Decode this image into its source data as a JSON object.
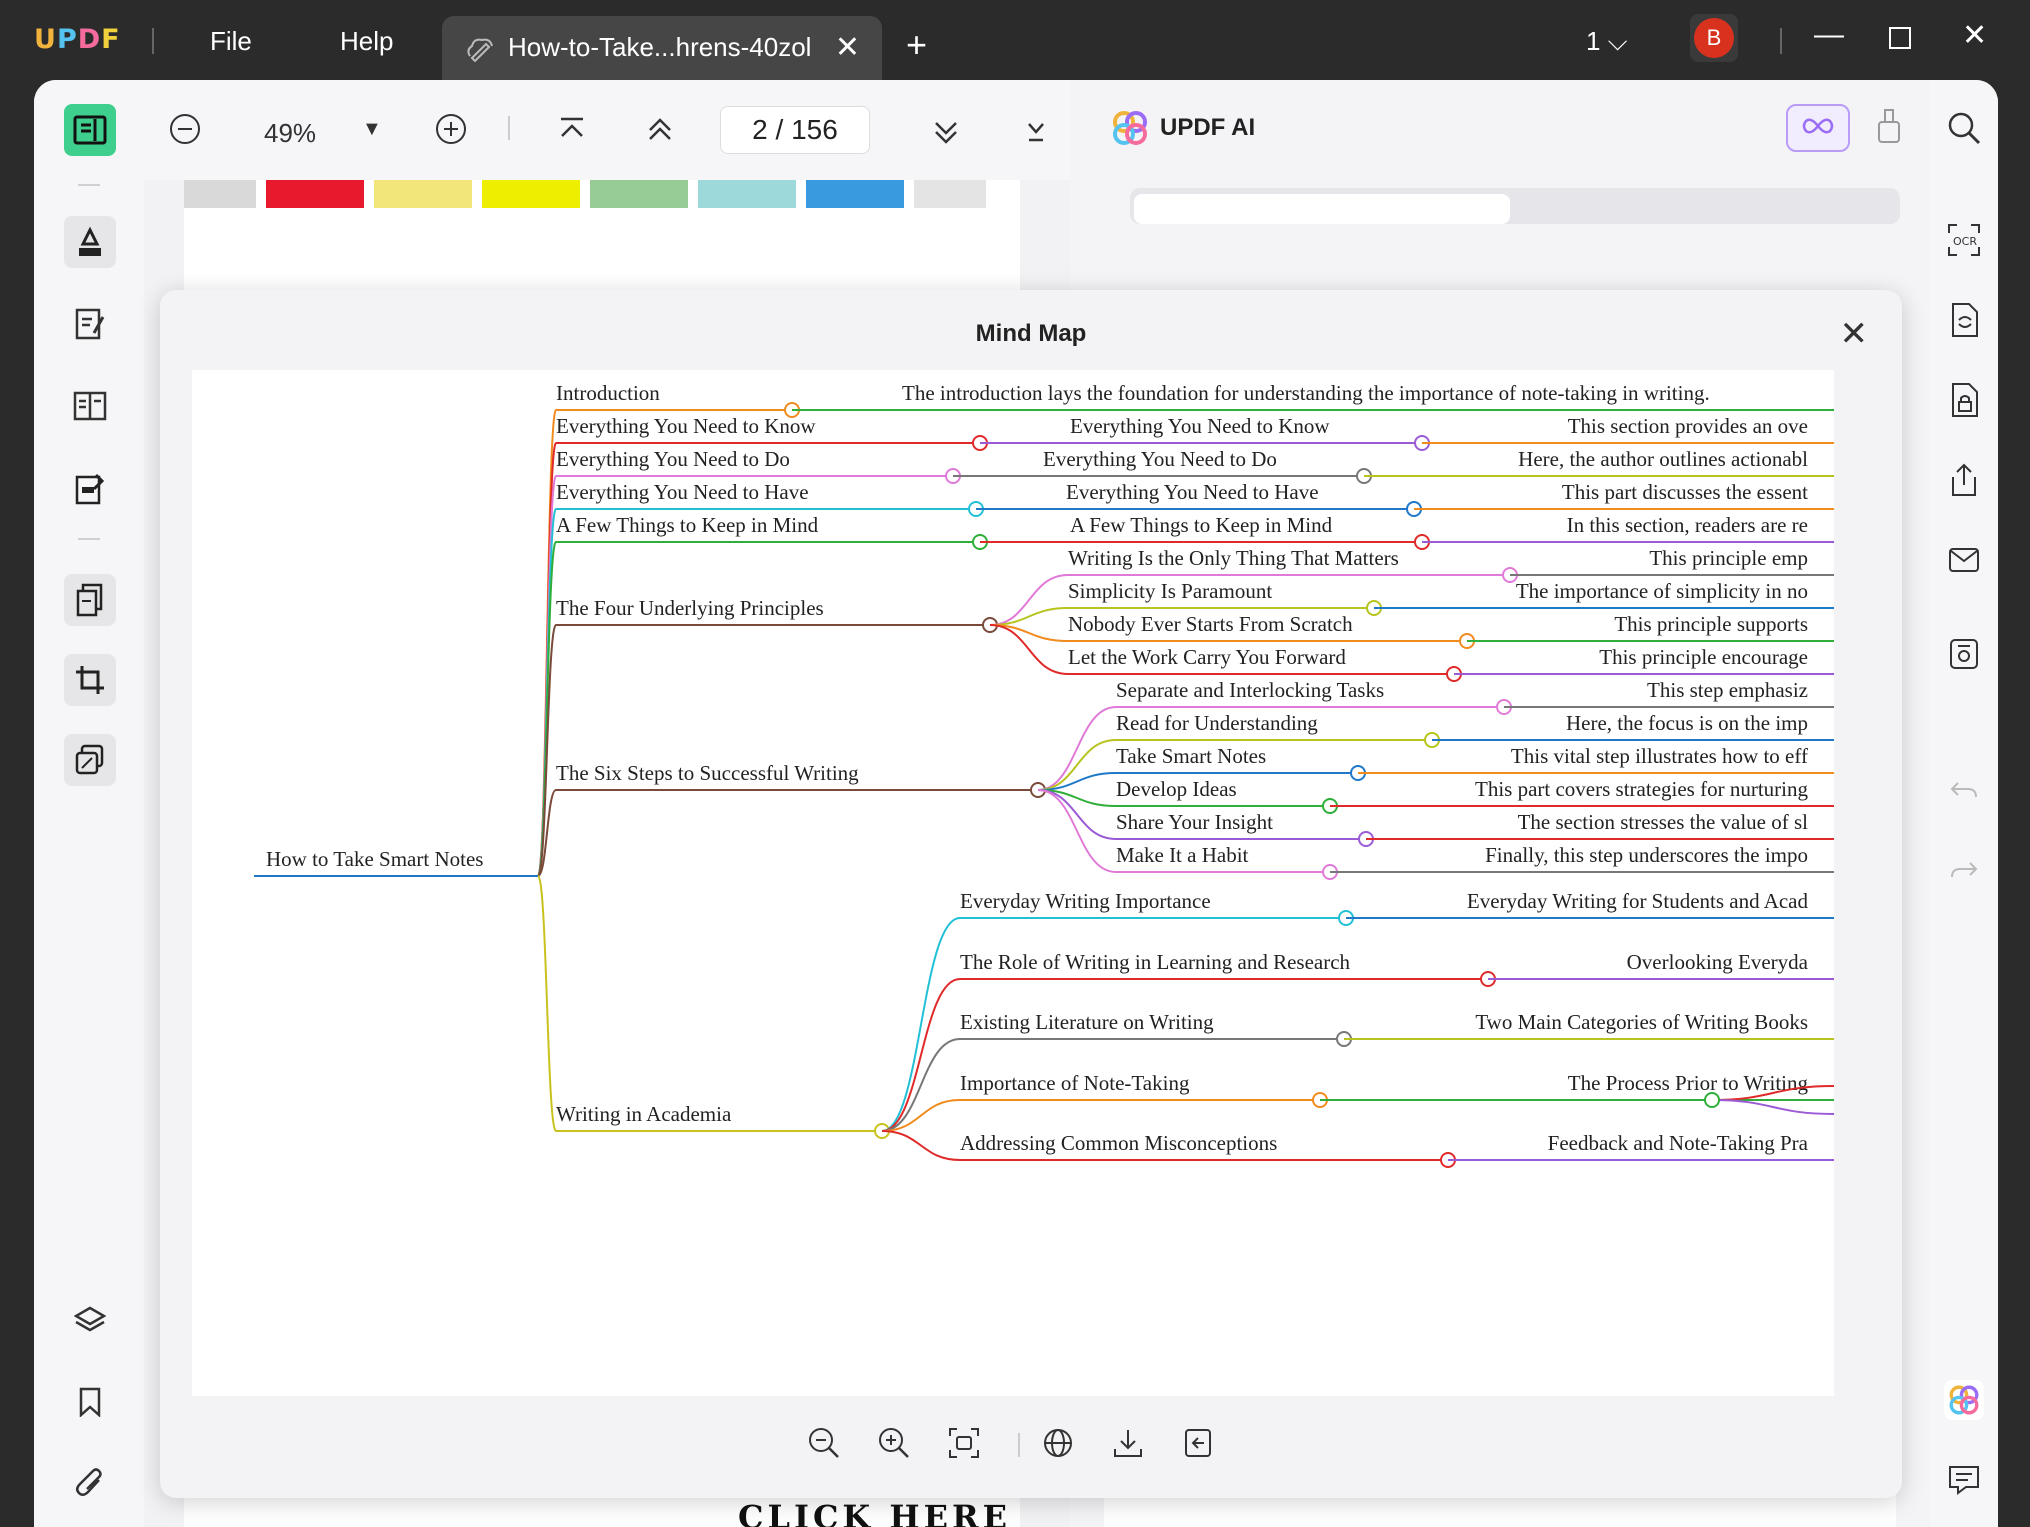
{
  "app": {
    "logo": [
      "U",
      "P",
      "D",
      "F"
    ],
    "menu": [
      "File",
      "Help"
    ],
    "tab_title": "How-to-Take...hrens-40zol",
    "page_selector": "1",
    "avatar": "B"
  },
  "toolbar": {
    "zoom": "49%",
    "page": "2  /  156"
  },
  "ai_panel": {
    "title": "UPDF AI"
  },
  "mindmap": {
    "title": "Mind Map",
    "root": "How to Take Smart Notes",
    "level1": [
      "Introduction",
      "Everything You Need to Know",
      "Everything You Need to Do",
      "Everything You Need to Have",
      "A Few Things to Keep in Mind",
      "The Four Underlying Principles",
      "The Six Steps to Successful Writing",
      "Writing in Academia"
    ],
    "level2": [
      "The introduction lays the foundation for understanding the importance of note-taking in writing.",
      "Everything You Need to Know",
      "Everything You Need to Do",
      "Everything You Need to Have",
      "A Few Things to Keep in Mind",
      "Writing Is the Only Thing That Matters",
      "Simplicity Is Paramount",
      "Nobody Ever Starts From Scratch",
      "Let the Work Carry You Forward",
      "Separate and Interlocking Tasks",
      "Read for Understanding",
      "Take Smart Notes",
      "Develop Ideas",
      "Share Your Insight",
      "Make It a Habit",
      "Everyday Writing Importance",
      "The Role of Writing in Learning and Research",
      "Existing Literature on Writing",
      "Importance of Note-Taking",
      "Addressing Common Misconceptions"
    ],
    "level3": [
      "This section provides an ove",
      "Here, the author outlines actionabl",
      "This part discusses the essent",
      "In this section, readers are re",
      "This principle emp",
      "The importance of simplicity in no",
      "This principle supports",
      "This principle encourage",
      "This step emphasiz",
      "Here, the focus is on the imp",
      "This vital step illustrates how to eff",
      "This part covers strategies for nurturing",
      "The section stresses the value of sl",
      "Finally, this step underscores the impo",
      "Everyday Writing for Students and Acad",
      "Overlooking Everyda",
      "Two Main Categories of Writing Books",
      "The Process Prior to Writing",
      "Feedback and Note-Taking Pra"
    ]
  },
  "document": {
    "cta": "CLICK HERE"
  },
  "colors": {
    "accent": "#3ecf8e",
    "close_red": "#d8321e",
    "ai_purple": "#9b6cf5"
  }
}
